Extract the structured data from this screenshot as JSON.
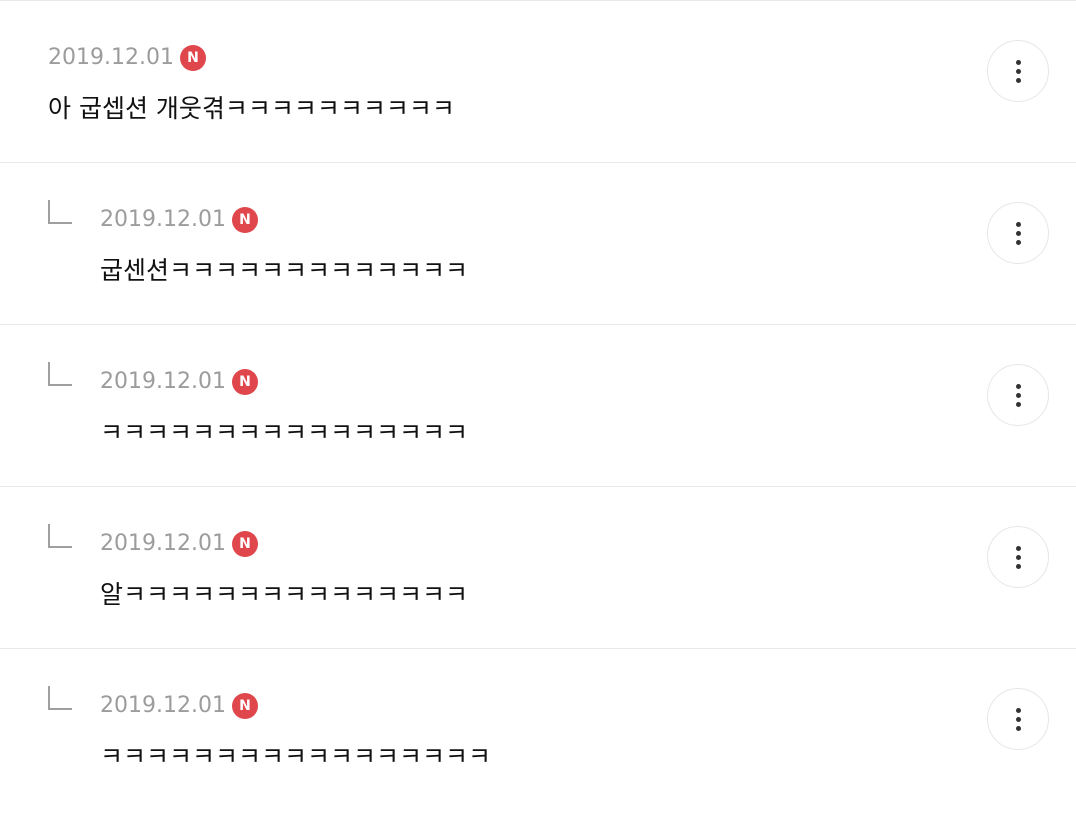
{
  "comments": [
    {
      "date": "2019.12.01",
      "badge": "N",
      "text": "아 굽셉션 개웃겪ㅋㅋㅋㅋㅋㅋㅋㅋㅋㅋ",
      "reply": false
    },
    {
      "date": "2019.12.01",
      "badge": "N",
      "text": "굽센션ㅋㅋㅋㅋㅋㅋㅋㅋㅋㅋㅋㅋㅋ",
      "reply": true
    },
    {
      "date": "2019.12.01",
      "badge": "N",
      "text": "ㅋㅋㅋㅋㅋㅋㅋㅋㅋㅋㅋㅋㅋㅋㅋㅋ",
      "reply": true
    },
    {
      "date": "2019.12.01",
      "badge": "N",
      "text": "알ㅋㅋㅋㅋㅋㅋㅋㅋㅋㅋㅋㅋㅋㅋㅋ",
      "reply": true
    },
    {
      "date": "2019.12.01",
      "badge": "N",
      "text": "ㅋㅋㅋㅋㅋㅋㅋㅋㅋㅋㅋㅋㅋㅋㅋㅋㅋ",
      "reply": true
    }
  ],
  "icons": {
    "more": "more-vertical-icon",
    "reply": "reply-arrow-icon",
    "new": "new-badge-icon"
  },
  "colors": {
    "badge": "#e0474c",
    "date": "#9c9c9c",
    "text": "#111111",
    "divider": "#e9e9e9"
  }
}
